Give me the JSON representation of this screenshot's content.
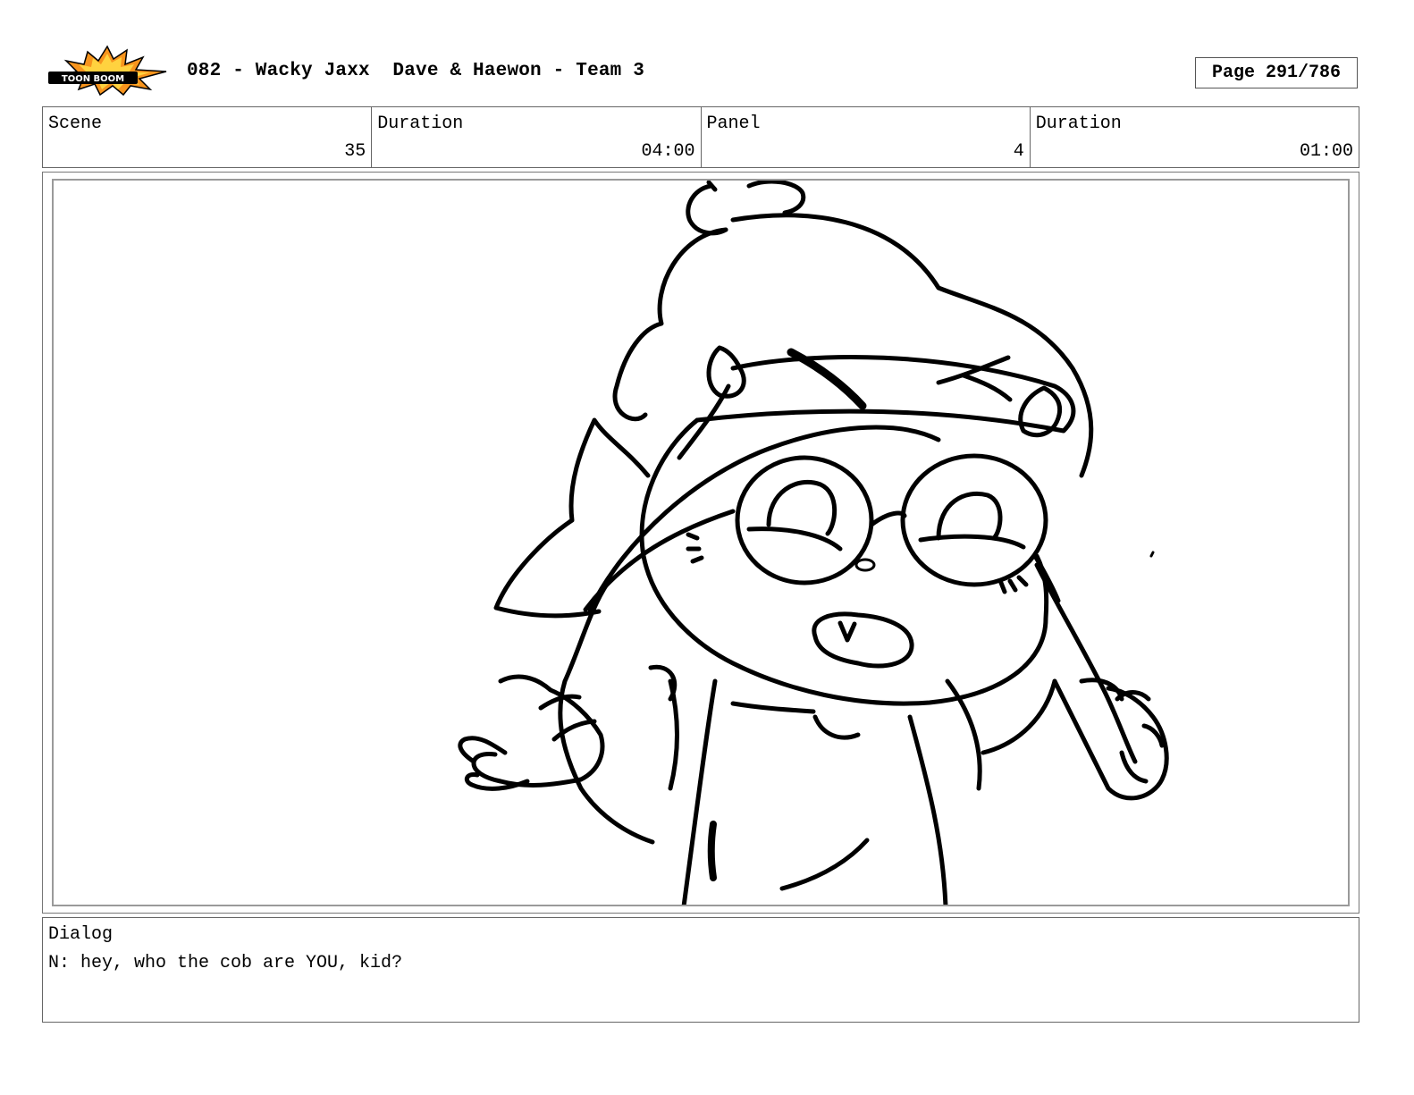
{
  "header": {
    "logo_text": "TOON BOOM",
    "title": "082 - Wacky Jaxx  Dave & Haewon - Team 3",
    "page": "Page 291/786"
  },
  "info": {
    "scene_label": "Scene",
    "scene_value": "35",
    "scene_duration_label": "Duration",
    "scene_duration_value": "04:00",
    "panel_label": "Panel",
    "panel_value": "4",
    "panel_duration_label": "Duration",
    "panel_duration_value": "01:00"
  },
  "panel": {
    "image_subject": "storyboard sketch of a character with glasses shrugging"
  },
  "dialog": {
    "label": "Dialog",
    "text": "N: hey, who the cob are YOU, kid?"
  },
  "colors": {
    "logo_burst": "#f7941d",
    "logo_outline": "#000000",
    "border": "#666666"
  }
}
